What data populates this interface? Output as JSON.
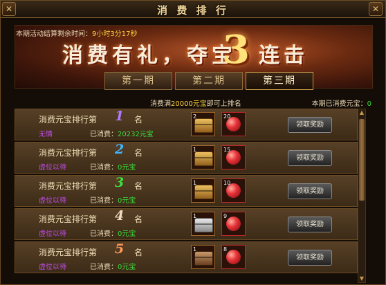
{
  "window": {
    "title": "消 费 排 行"
  },
  "countdown": {
    "label": "本期活动结算剩余时间：",
    "value": "9小时3分17秒"
  },
  "banner": {
    "text_a": "消费有礼，夺宝",
    "number": "3",
    "text_b": "连击"
  },
  "tabs": [
    {
      "label": "第一期",
      "active": false
    },
    {
      "label": "第二期",
      "active": false
    },
    {
      "label": "第三期",
      "active": true
    }
  ],
  "info": {
    "req_prefix": "消费满",
    "req_amount": "20000元宝",
    "req_suffix": "即可上排名",
    "my_spent_label": "本期已消费元宝：",
    "my_spent_value": "0"
  },
  "rank_label": "消费元宝排行第",
  "rank_suffix": "名",
  "spent_label": "已消费：",
  "claim_label": "领取奖励",
  "rows": [
    {
      "rank": "1",
      "rank_color": "#b07cff",
      "player": "无情",
      "spent": "20232元宝",
      "chest": "gold",
      "chest_count": "2",
      "gem_count": "20"
    },
    {
      "rank": "2",
      "rank_color": "#3fb6ff",
      "player": "虚位以待",
      "spent": "0元宝",
      "chest": "gold",
      "chest_count": "1",
      "gem_count": "15"
    },
    {
      "rank": "3",
      "rank_color": "#3ce33c",
      "player": "虚位以待",
      "spent": "0元宝",
      "chest": "gold",
      "chest_count": "1",
      "gem_count": "10"
    },
    {
      "rank": "4",
      "rank_color": "#f2dcc0",
      "player": "虚位以待",
      "spent": "0元宝",
      "chest": "silver",
      "chest_count": "1",
      "gem_count": "9"
    },
    {
      "rank": "5",
      "rank_color": "#ff9a5a",
      "player": "虚位以待",
      "spent": "0元宝",
      "chest": "bronze",
      "chest_count": "1",
      "gem_count": "8"
    }
  ]
}
